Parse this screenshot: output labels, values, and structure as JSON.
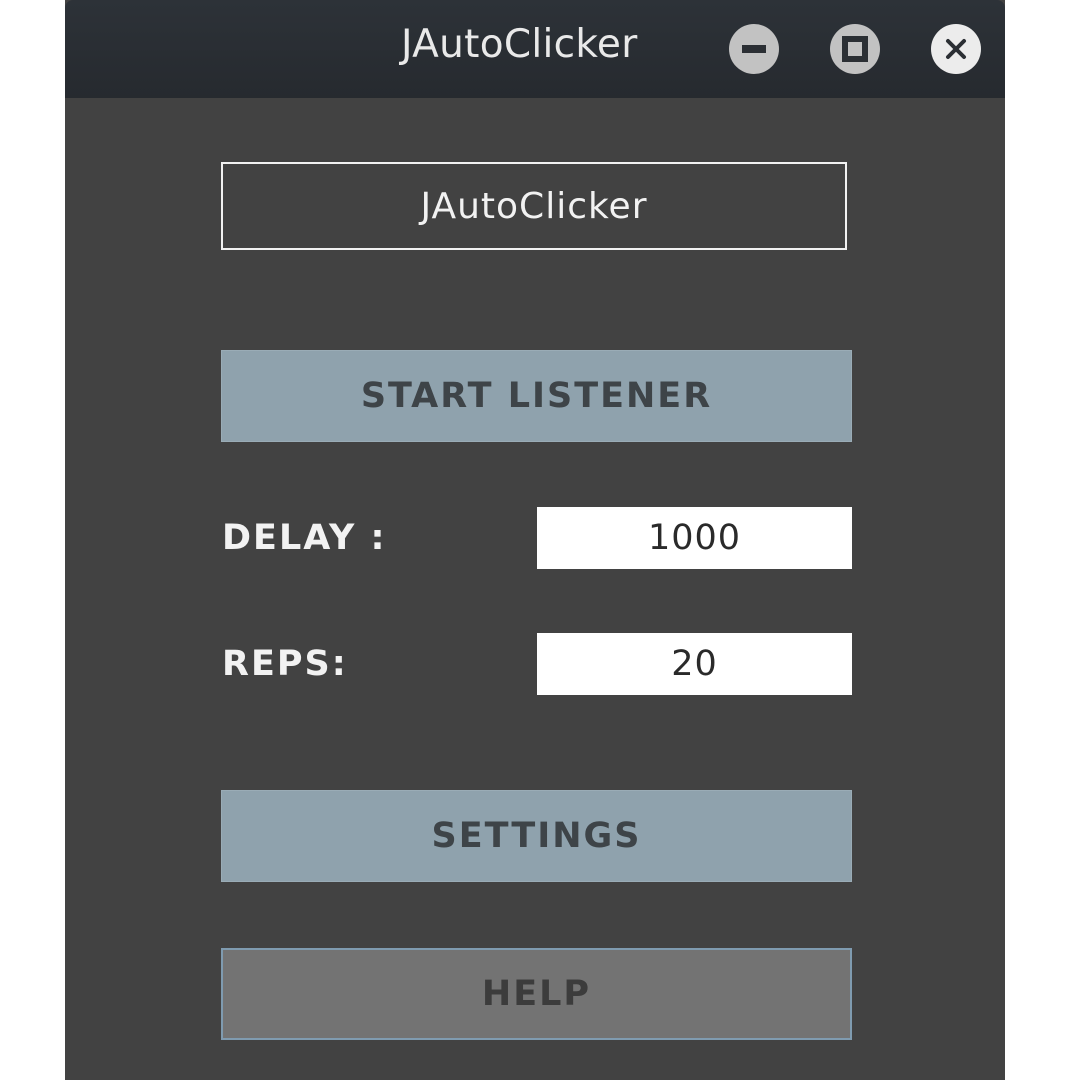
{
  "window": {
    "title": "JAutoClicker",
    "controls": {
      "minimize_icon": "minimize-icon",
      "maximize_icon": "maximize-icon",
      "close_icon": "close-icon"
    }
  },
  "main": {
    "header_label": "JAutoClicker",
    "start_button_label": "START LISTENER",
    "delay": {
      "label": "DELAY :",
      "value": "1000"
    },
    "reps": {
      "label": "REPS:",
      "value": "20"
    },
    "settings_button_label": "SETTINGS",
    "help_button_label": "HELP"
  },
  "colors": {
    "background": "#424242",
    "titlebar": "#2a2e33",
    "primary_button": "#8fa2ad",
    "disabled_button": "#737373",
    "text_light": "#f2f2f2"
  }
}
